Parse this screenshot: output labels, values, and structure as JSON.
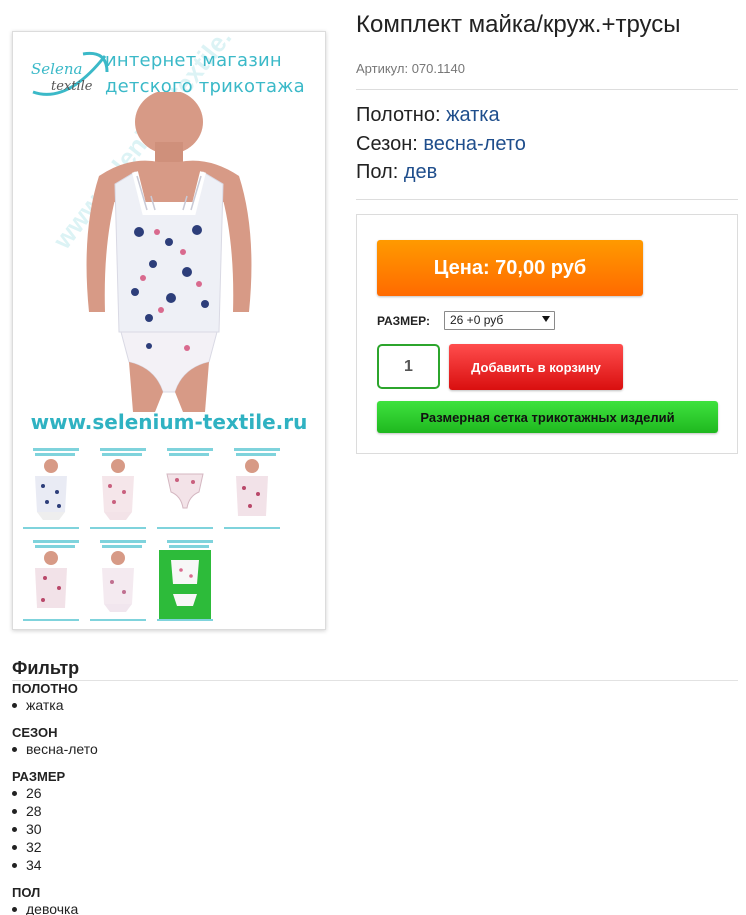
{
  "gallery": {
    "brand": {
      "logo_line1": "Selena",
      "logo_line2": "textile",
      "tagline_1": "интернет магазин",
      "tagline_2": "детского трикотажа"
    },
    "site_url": "www.selenium-textile.ru",
    "watermark": "www.selenium-textile.ru",
    "thumbnails": [
      {
        "icon": "thumbnail-tank-set-navy"
      },
      {
        "icon": "thumbnail-tank-set-pink"
      },
      {
        "icon": "thumbnail-briefs"
      },
      {
        "icon": "thumbnail-tank-pink-floral"
      },
      {
        "icon": "thumbnail-tank-pink-floral-2"
      },
      {
        "icon": "thumbnail-tank-pink"
      },
      {
        "icon": "thumbnail-set-green-background"
      }
    ]
  },
  "product": {
    "title": "Комплект майка/круж.+трусы",
    "sku": "Артикул: 070.1140",
    "attributes": [
      {
        "label": "Полотно: ",
        "value": "жатка"
      },
      {
        "label": "Сезон: ",
        "value": "весна-лето"
      },
      {
        "label": "Пол: ",
        "value": "дев"
      }
    ]
  },
  "buy_box": {
    "price_label": "Цена: 70,00 руб",
    "size_label": "РАЗМЕР:",
    "size_selected": "26 +0 руб",
    "quantity": "1",
    "add_to_cart": "Добавить в корзину",
    "size_chart": "Размерная сетка трикотажных изделий"
  },
  "filter": {
    "title": "Фильтр",
    "groups": [
      {
        "title": "ПОЛОТНО",
        "items": [
          "жатка"
        ]
      },
      {
        "title": "СЕЗОН",
        "items": [
          "весна-лето"
        ]
      },
      {
        "title": "РАЗМЕР",
        "items": [
          "26",
          "28",
          "30",
          "32",
          "34"
        ]
      },
      {
        "title": "ПОЛ",
        "items": [
          "девочка"
        ]
      }
    ]
  },
  "colors": {
    "link": "#1f4e8c",
    "price_button": "#ff7f00",
    "cart_button": "#e61e1e",
    "size_chart_button": "#2ecc2e",
    "brand_teal": "#3bb9c8"
  }
}
